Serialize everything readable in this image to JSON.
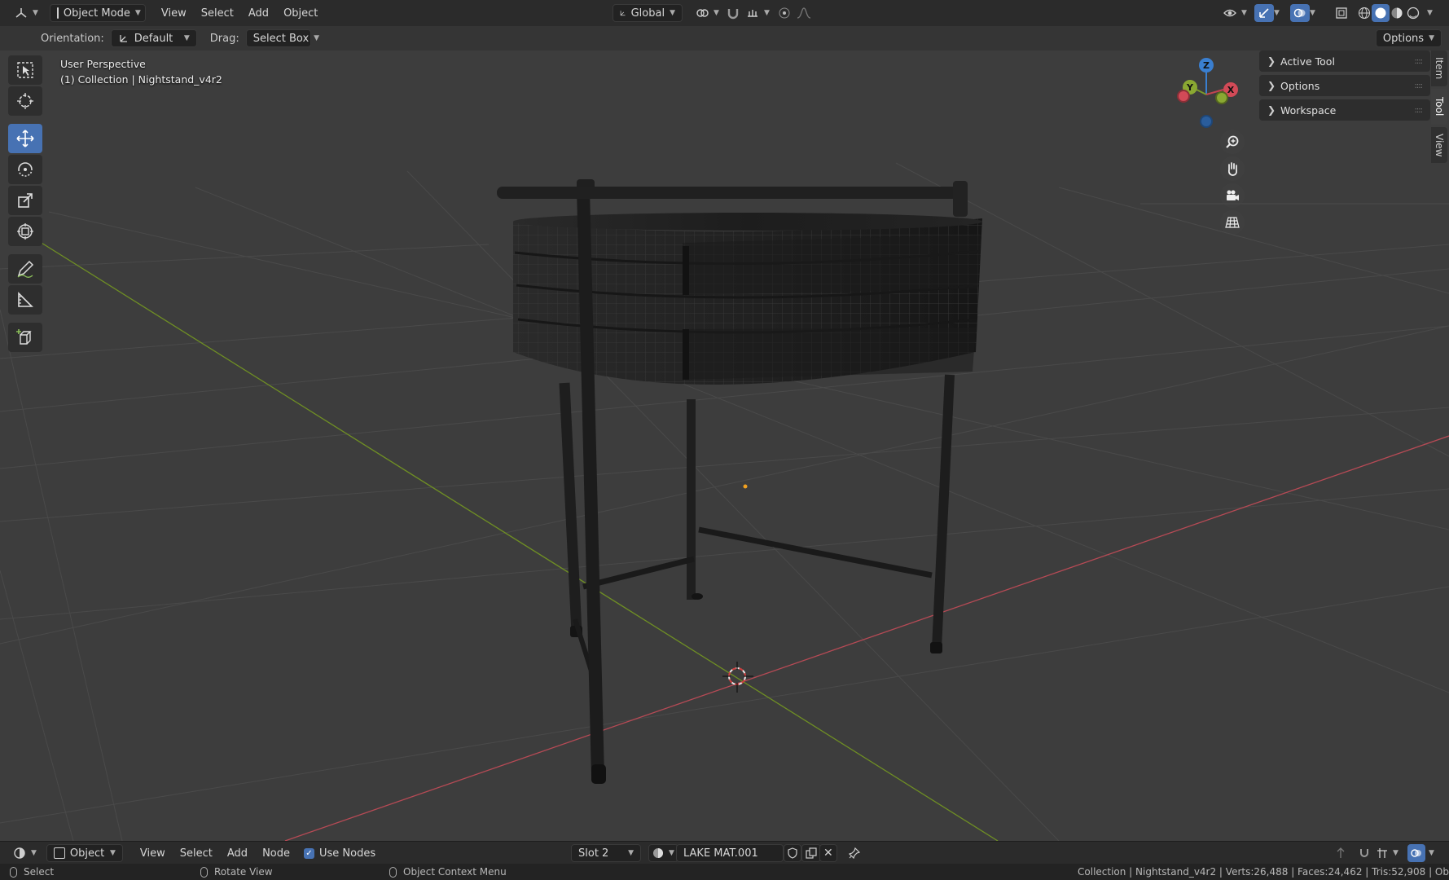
{
  "header": {
    "mode_label": "Object Mode",
    "menus": [
      "View",
      "Select",
      "Add",
      "Object"
    ],
    "transform_orientation": "Global",
    "options_label": "Options"
  },
  "tool_options": {
    "orientation_label": "Orientation:",
    "orientation_value": "Default",
    "drag_label": "Drag:",
    "drag_value": "Select Box"
  },
  "viewport": {
    "view_name": "User Perspective",
    "collection_info": "(1) Collection | Nightstand_v4r2",
    "gizmo": {
      "z": "Z",
      "y": "Y",
      "x": "X"
    }
  },
  "toolbar": {
    "tools": [
      "select-box-tool",
      "cursor-tool",
      "move-tool",
      "rotate-tool",
      "scale-tool",
      "transform-tool",
      "annotate-tool",
      "measure-tool",
      "add-cube-tool"
    ],
    "active": "move-tool"
  },
  "npanel": {
    "sections": [
      "Active Tool",
      "Options",
      "Workspace"
    ],
    "tabs": [
      "Item",
      "Tool",
      "View"
    ],
    "active_tab": "Tool"
  },
  "node_header": {
    "editor_type": "Object",
    "menus": [
      "View",
      "Select",
      "Add",
      "Node"
    ],
    "use_nodes_label": "Use Nodes",
    "slot": "Slot 2",
    "material": "LAKE MAT.001"
  },
  "status_bar": {
    "select": "Select",
    "rotate": "Rotate View",
    "context": "Object Context Menu",
    "stats": "Collection | Nightstand_v4r2 | Verts:26,488 | Faces:24,462 | Tris:52,908 | Ob"
  },
  "colors": {
    "accent": "#4772b3",
    "x_axis": "#c04550",
    "y_axis": "#7a9a2a",
    "z_axis": "#3a7fd0"
  }
}
